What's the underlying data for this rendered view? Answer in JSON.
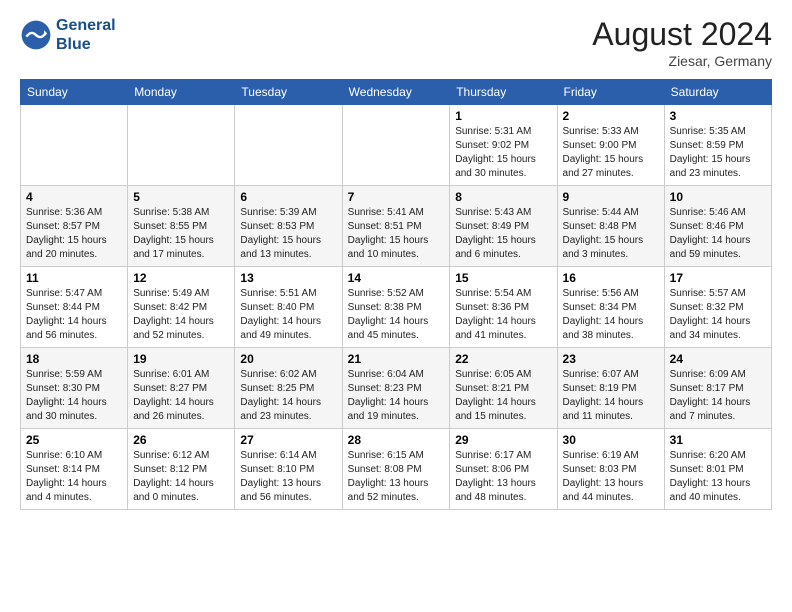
{
  "header": {
    "logo_line1": "General",
    "logo_line2": "Blue",
    "month_year": "August 2024",
    "location": "Ziesar, Germany"
  },
  "weekdays": [
    "Sunday",
    "Monday",
    "Tuesday",
    "Wednesday",
    "Thursday",
    "Friday",
    "Saturday"
  ],
  "weeks": [
    [
      {
        "day": "",
        "info": ""
      },
      {
        "day": "",
        "info": ""
      },
      {
        "day": "",
        "info": ""
      },
      {
        "day": "",
        "info": ""
      },
      {
        "day": "1",
        "info": "Sunrise: 5:31 AM\nSunset: 9:02 PM\nDaylight: 15 hours\nand 30 minutes."
      },
      {
        "day": "2",
        "info": "Sunrise: 5:33 AM\nSunset: 9:00 PM\nDaylight: 15 hours\nand 27 minutes."
      },
      {
        "day": "3",
        "info": "Sunrise: 5:35 AM\nSunset: 8:59 PM\nDaylight: 15 hours\nand 23 minutes."
      }
    ],
    [
      {
        "day": "4",
        "info": "Sunrise: 5:36 AM\nSunset: 8:57 PM\nDaylight: 15 hours\nand 20 minutes."
      },
      {
        "day": "5",
        "info": "Sunrise: 5:38 AM\nSunset: 8:55 PM\nDaylight: 15 hours\nand 17 minutes."
      },
      {
        "day": "6",
        "info": "Sunrise: 5:39 AM\nSunset: 8:53 PM\nDaylight: 15 hours\nand 13 minutes."
      },
      {
        "day": "7",
        "info": "Sunrise: 5:41 AM\nSunset: 8:51 PM\nDaylight: 15 hours\nand 10 minutes."
      },
      {
        "day": "8",
        "info": "Sunrise: 5:43 AM\nSunset: 8:49 PM\nDaylight: 15 hours\nand 6 minutes."
      },
      {
        "day": "9",
        "info": "Sunrise: 5:44 AM\nSunset: 8:48 PM\nDaylight: 15 hours\nand 3 minutes."
      },
      {
        "day": "10",
        "info": "Sunrise: 5:46 AM\nSunset: 8:46 PM\nDaylight: 14 hours\nand 59 minutes."
      }
    ],
    [
      {
        "day": "11",
        "info": "Sunrise: 5:47 AM\nSunset: 8:44 PM\nDaylight: 14 hours\nand 56 minutes."
      },
      {
        "day": "12",
        "info": "Sunrise: 5:49 AM\nSunset: 8:42 PM\nDaylight: 14 hours\nand 52 minutes."
      },
      {
        "day": "13",
        "info": "Sunrise: 5:51 AM\nSunset: 8:40 PM\nDaylight: 14 hours\nand 49 minutes."
      },
      {
        "day": "14",
        "info": "Sunrise: 5:52 AM\nSunset: 8:38 PM\nDaylight: 14 hours\nand 45 minutes."
      },
      {
        "day": "15",
        "info": "Sunrise: 5:54 AM\nSunset: 8:36 PM\nDaylight: 14 hours\nand 41 minutes."
      },
      {
        "day": "16",
        "info": "Sunrise: 5:56 AM\nSunset: 8:34 PM\nDaylight: 14 hours\nand 38 minutes."
      },
      {
        "day": "17",
        "info": "Sunrise: 5:57 AM\nSunset: 8:32 PM\nDaylight: 14 hours\nand 34 minutes."
      }
    ],
    [
      {
        "day": "18",
        "info": "Sunrise: 5:59 AM\nSunset: 8:30 PM\nDaylight: 14 hours\nand 30 minutes."
      },
      {
        "day": "19",
        "info": "Sunrise: 6:01 AM\nSunset: 8:27 PM\nDaylight: 14 hours\nand 26 minutes."
      },
      {
        "day": "20",
        "info": "Sunrise: 6:02 AM\nSunset: 8:25 PM\nDaylight: 14 hours\nand 23 minutes."
      },
      {
        "day": "21",
        "info": "Sunrise: 6:04 AM\nSunset: 8:23 PM\nDaylight: 14 hours\nand 19 minutes."
      },
      {
        "day": "22",
        "info": "Sunrise: 6:05 AM\nSunset: 8:21 PM\nDaylight: 14 hours\nand 15 minutes."
      },
      {
        "day": "23",
        "info": "Sunrise: 6:07 AM\nSunset: 8:19 PM\nDaylight: 14 hours\nand 11 minutes."
      },
      {
        "day": "24",
        "info": "Sunrise: 6:09 AM\nSunset: 8:17 PM\nDaylight: 14 hours\nand 7 minutes."
      }
    ],
    [
      {
        "day": "25",
        "info": "Sunrise: 6:10 AM\nSunset: 8:14 PM\nDaylight: 14 hours\nand 4 minutes."
      },
      {
        "day": "26",
        "info": "Sunrise: 6:12 AM\nSunset: 8:12 PM\nDaylight: 14 hours\nand 0 minutes."
      },
      {
        "day": "27",
        "info": "Sunrise: 6:14 AM\nSunset: 8:10 PM\nDaylight: 13 hours\nand 56 minutes."
      },
      {
        "day": "28",
        "info": "Sunrise: 6:15 AM\nSunset: 8:08 PM\nDaylight: 13 hours\nand 52 minutes."
      },
      {
        "day": "29",
        "info": "Sunrise: 6:17 AM\nSunset: 8:06 PM\nDaylight: 13 hours\nand 48 minutes."
      },
      {
        "day": "30",
        "info": "Sunrise: 6:19 AM\nSunset: 8:03 PM\nDaylight: 13 hours\nand 44 minutes."
      },
      {
        "day": "31",
        "info": "Sunrise: 6:20 AM\nSunset: 8:01 PM\nDaylight: 13 hours\nand 40 minutes."
      }
    ]
  ]
}
